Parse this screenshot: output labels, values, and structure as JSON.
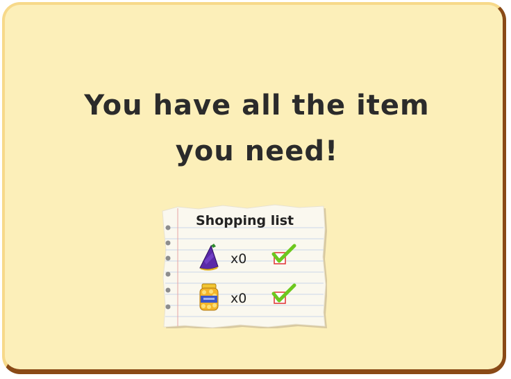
{
  "message": {
    "line1": "You have all the item",
    "line2": "you need!"
  },
  "shopping_list": {
    "title": "Shopping list",
    "items": [
      {
        "icon": "party-hat-icon",
        "quantity_label": "x0",
        "checked": true
      },
      {
        "icon": "popcorn-jar-icon",
        "quantity_label": "x0",
        "checked": true
      }
    ]
  },
  "colors": {
    "panel_background": "#fcefb9",
    "panel_border": "#8a4a16",
    "check_green": "#6cc81e",
    "checkbox_red": "#e03030",
    "paper": "#faf8ef",
    "paper_lines": "#c9d6e8",
    "margin_line": "#e6a3a3"
  }
}
